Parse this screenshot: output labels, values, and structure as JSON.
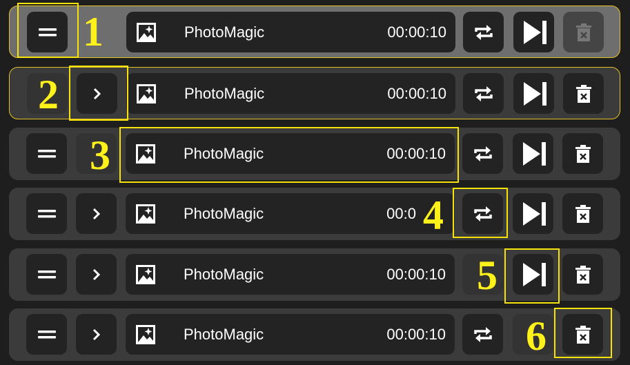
{
  "rows": [
    {
      "title": "PhotoMagic",
      "time": "00:00:10"
    },
    {
      "title": "PhotoMagic",
      "time": "00:00:10"
    },
    {
      "title": "PhotoMagic",
      "time": "00:00:10"
    },
    {
      "title": "PhotoMagic",
      "time": "00:0"
    },
    {
      "title": "PhotoMagic",
      "time": "00:00:10"
    },
    {
      "title": "PhotoMagic",
      "time": "00:00:10"
    }
  ],
  "callouts": [
    "1",
    "2",
    "3",
    "4",
    "5",
    "6"
  ],
  "icons": {
    "drag": "drag-handle-icon",
    "expand": "chevron-right-icon",
    "image": "image-sparkle-icon",
    "repeat": "repeat-icon",
    "next": "skip-next-icon",
    "delete": "trash-icon"
  },
  "colors": {
    "highlight": "#f7e30c",
    "row_bg": "#3b3b3b",
    "button_bg": "#232323"
  }
}
